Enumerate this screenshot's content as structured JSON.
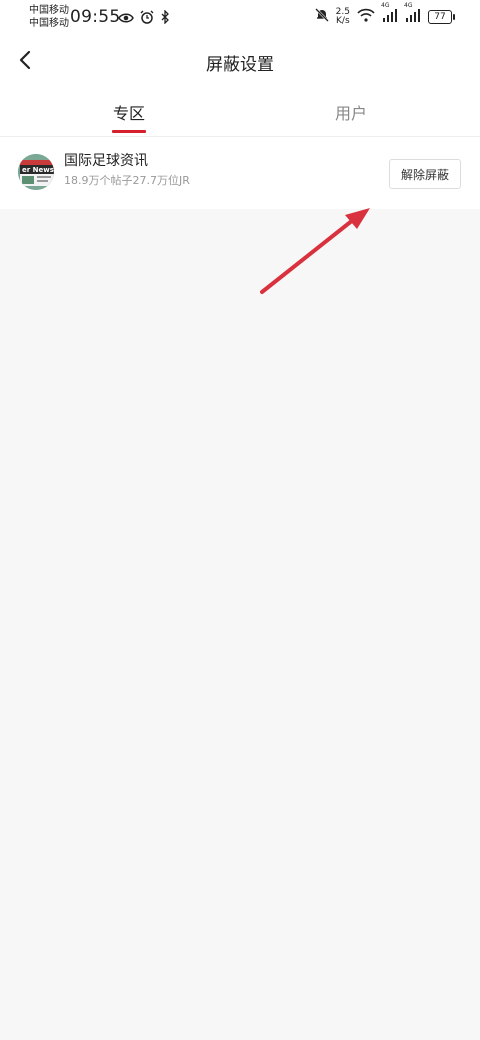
{
  "status_bar": {
    "carrier_1": "中国移动",
    "carrier_2": "中国移动",
    "time": "09:55",
    "net_speed_value": "2.5",
    "net_speed_unit": "K/s",
    "signal_1_label": "4G",
    "signal_2_label": "4G",
    "battery": "77"
  },
  "header": {
    "title": "屏蔽设置"
  },
  "tabs": [
    {
      "label": "专区",
      "active": true
    },
    {
      "label": "用户",
      "active": false
    }
  ],
  "blocked_list": [
    {
      "name": "国际足球资讯",
      "stats": "18.9万个帖子27.7万位JR",
      "avatar_text": "er News",
      "action_label": "解除屏蔽"
    }
  ],
  "colors": {
    "accent": "#d6202d",
    "arrow": "#d9313e",
    "background": "#f7f7f7"
  }
}
